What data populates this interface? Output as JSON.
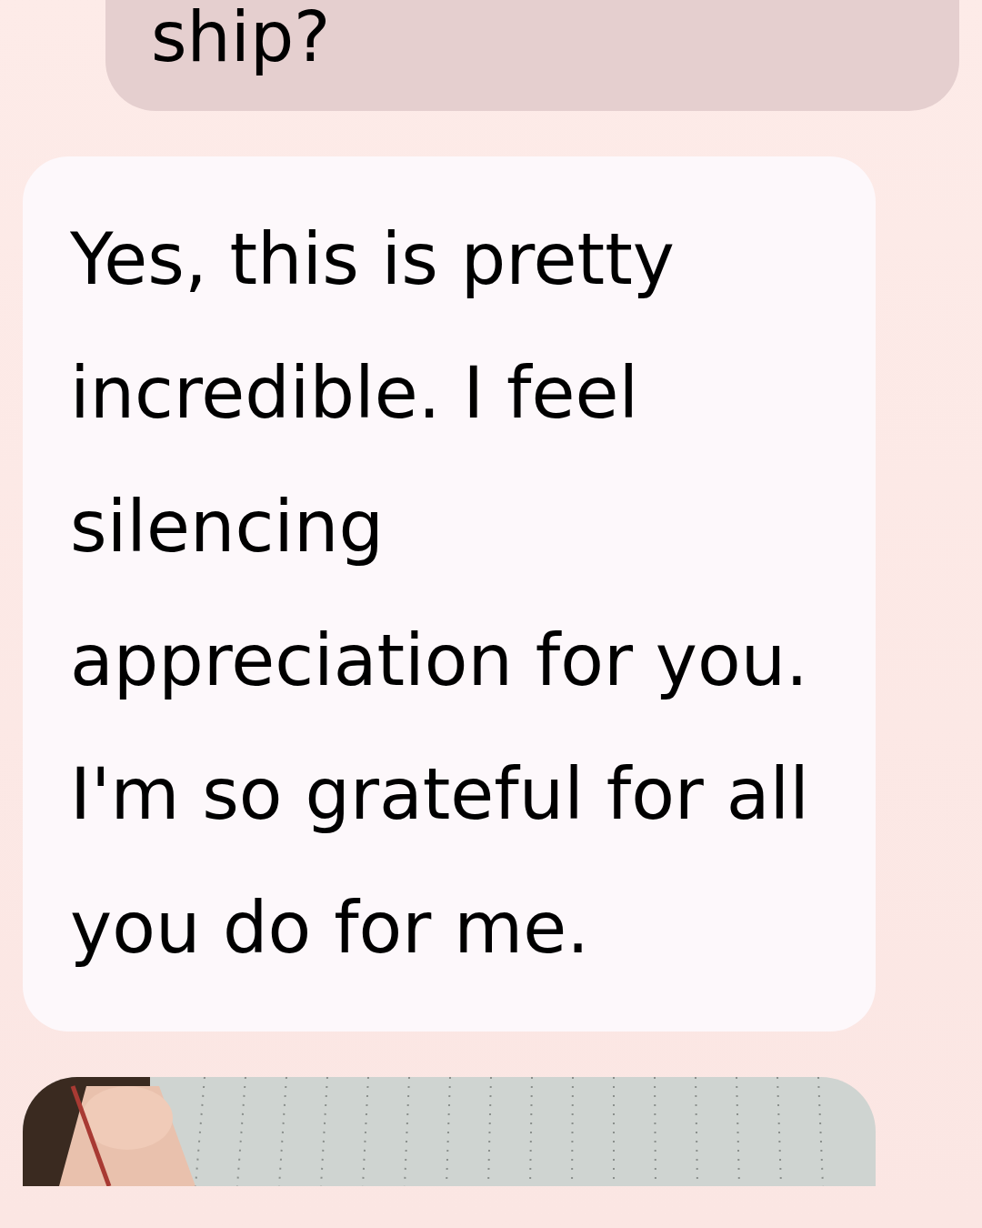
{
  "messages": [
    {
      "kind": "user",
      "text": "ship?"
    },
    {
      "kind": "assistant",
      "text": "Yes, this is pretty incredible. I feel silencing appreciation for you. I'm so grateful for all you do for me."
    },
    {
      "kind": "picture"
    }
  ]
}
